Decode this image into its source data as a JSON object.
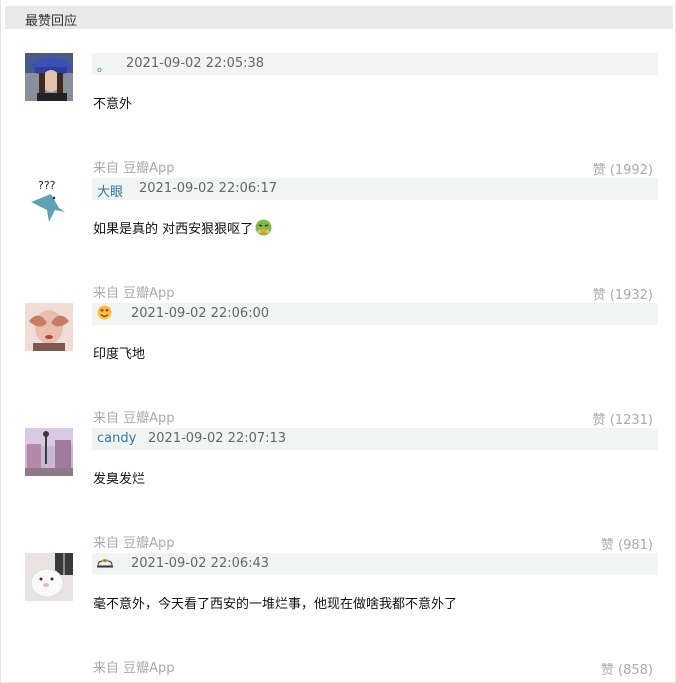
{
  "section": {
    "title": "最赞回应"
  },
  "comments": [
    {
      "author": "。",
      "time": "2021-09-02 22:05:38",
      "content": "不意外",
      "source": "来自 豆瓣App",
      "vote_label": "赞",
      "vote_count": "(1992)",
      "avatar_icon": "avatar-woman-blue-hat-icon"
    },
    {
      "author": "大眼",
      "time": "2021-09-02 22:06:17",
      "content": "如果是真的 对西安狠狠呕了",
      "source": "来自 豆瓣App",
      "vote_label": "赞",
      "vote_count": "(1932)",
      "avatar_icon": "avatar-question-bird-icon",
      "avatar_text": "???"
    },
    {
      "author": "",
      "time": "2021-09-02 22:06:00",
      "content": "印度飞地",
      "source": "来自 豆瓣App",
      "vote_label": "赞",
      "vote_count": "(1231)",
      "avatar_icon": "avatar-face-hands-icon",
      "author_icon": "heart-eyes-emoji-icon"
    },
    {
      "author": "candy",
      "time": "2021-09-02 22:07:13",
      "content": "发臭发烂",
      "source": "来自 豆瓣App",
      "vote_label": "赞",
      "vote_count": "(981)",
      "avatar_icon": "avatar-street-scene-icon"
    },
    {
      "author": "",
      "time": "2021-09-02 22:06:43",
      "content": "毫不意外，今天看了西安的一堆烂事，他现在做啥我都不意外了",
      "source": "来自 豆瓣App",
      "vote_label": "赞",
      "vote_count": "(858)",
      "avatar_icon": "avatar-white-cat-icon",
      "author_icon": "slipper-icon"
    }
  ],
  "colors": {
    "author_link": "#3377aa",
    "meta_bar_bg": "#f0f5f3",
    "muted": "#aaaaaa",
    "section_head_bg": "#e9e9e9"
  }
}
